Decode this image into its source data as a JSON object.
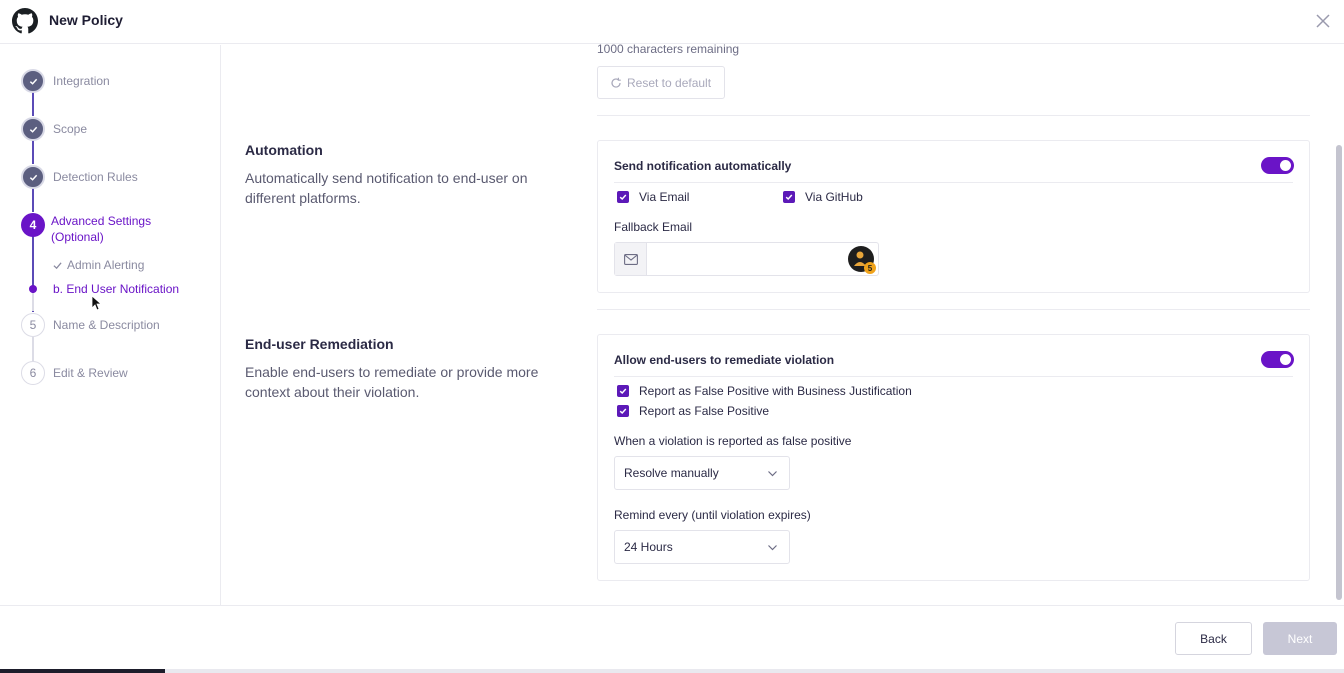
{
  "header": {
    "title": "New Policy",
    "logo_icon": "github-icon",
    "close_icon": "close-icon"
  },
  "steps": [
    {
      "label": "Integration",
      "state": "done"
    },
    {
      "label": "Scope",
      "state": "done"
    },
    {
      "label": "Detection Rules",
      "state": "done"
    },
    {
      "number": "4",
      "label_line1": "Advanced Settings",
      "label_line2": "(Optional)",
      "state": "active"
    },
    {
      "number": "5",
      "label": "Name & Description",
      "state": "todo"
    },
    {
      "number": "6",
      "label": "Edit & Review",
      "state": "todo"
    }
  ],
  "substeps": [
    {
      "label": "Admin Alerting",
      "state": "done"
    },
    {
      "label": "b. End User Notification",
      "state": "current"
    }
  ],
  "top": {
    "chars_remaining": "1000 characters remaining",
    "reset_label": "Reset to default"
  },
  "automation": {
    "title": "Automation",
    "description": "Automatically send notification to end-user on different platforms.",
    "card_title": "Send notification automatically",
    "toggle_on": true,
    "via_email": "Via Email",
    "via_github": "Via GitHub",
    "fallback_label": "Fallback Email",
    "fallback_value": "",
    "avatar_badge": "5"
  },
  "remediation": {
    "title": "End-user Remediation",
    "description": "Enable end-users to remediate or provide more context about their violation.",
    "card_title": "Allow end-users to remediate violation",
    "toggle_on": true,
    "option1": "Report as False Positive with Business Justification",
    "option2": "Report as False Positive",
    "fp_label": "When a violation is reported as false positive",
    "fp_value": "Resolve manually",
    "remind_label": "Remind every (until violation expires)",
    "remind_value": "24 Hours"
  },
  "footer": {
    "back_label": "Back",
    "next_label": "Next"
  },
  "colors": {
    "accent": "#6a14c7",
    "done_step": "#5c5f80",
    "next_disabled": "#c7c7d6"
  }
}
